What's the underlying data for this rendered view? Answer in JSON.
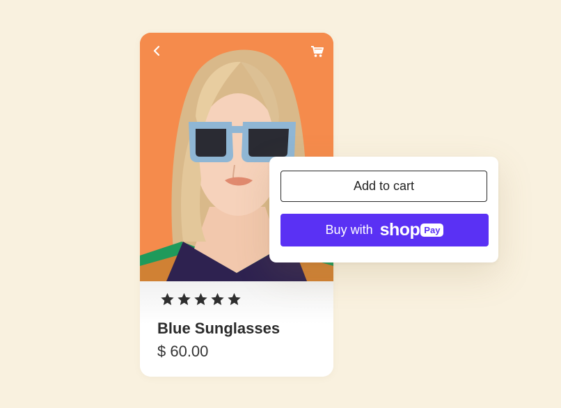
{
  "colors": {
    "background": "#f9f1df",
    "hero": "#f58b4c",
    "shop_pay_purple": "#5a31f4",
    "frame_blue": "#8fb6d4"
  },
  "product": {
    "title": "Blue Sunglasses",
    "price": "$ 60.00",
    "rating": 5,
    "rating_max": 5
  },
  "icons": {
    "back": "chevron-left-icon",
    "cart": "cart-icon",
    "star": "star-icon"
  },
  "actions": {
    "add_to_cart": "Add to cart",
    "buy_with": "Buy with",
    "shop_logo": "shop",
    "pay_badge": "Pay"
  }
}
